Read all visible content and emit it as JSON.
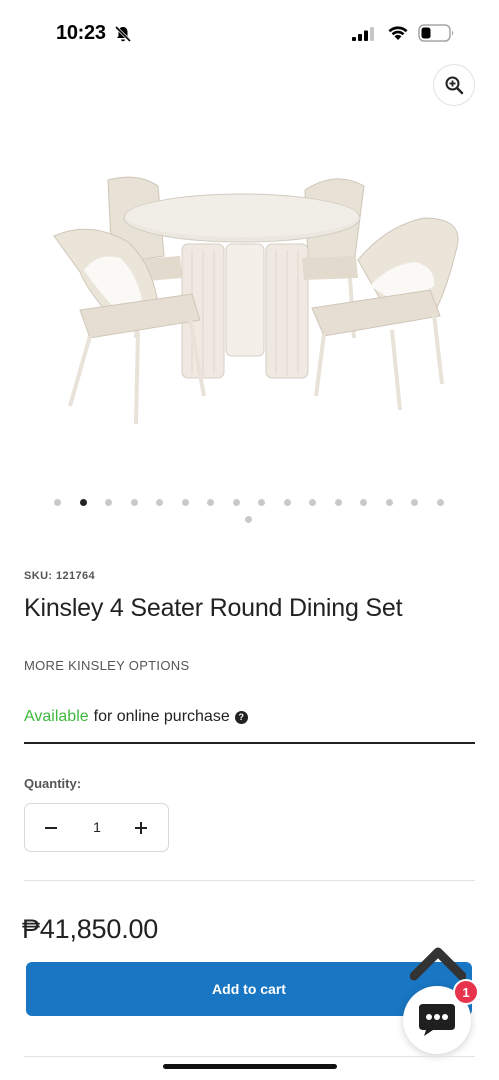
{
  "status_bar": {
    "time": "10:23",
    "icons": [
      "bell-slash-icon",
      "signal-icon",
      "wifi-icon",
      "battery-icon"
    ]
  },
  "gallery": {
    "zoom_icon": "zoom-in-icon",
    "image": "round-dining-table-with-four-chairs",
    "dots_total": 17,
    "active_index": 1
  },
  "product": {
    "sku": "SKU: 121764",
    "title": "Kinsley 4 Seater Round Dining Set",
    "more_options": "MORE KINSLEY OPTIONS",
    "availability_status": "Available",
    "availability_text": "for online purchase",
    "help_icon_label": "?"
  },
  "quantity": {
    "label": "Quantity:",
    "value": "1"
  },
  "price": "₱41,850.00",
  "add_to_cart_label": "Add to cart",
  "chat": {
    "badge_count": "1"
  },
  "colors": {
    "primary": "#1976c2",
    "available": "#3fb93f",
    "badge": "#e8334d"
  }
}
